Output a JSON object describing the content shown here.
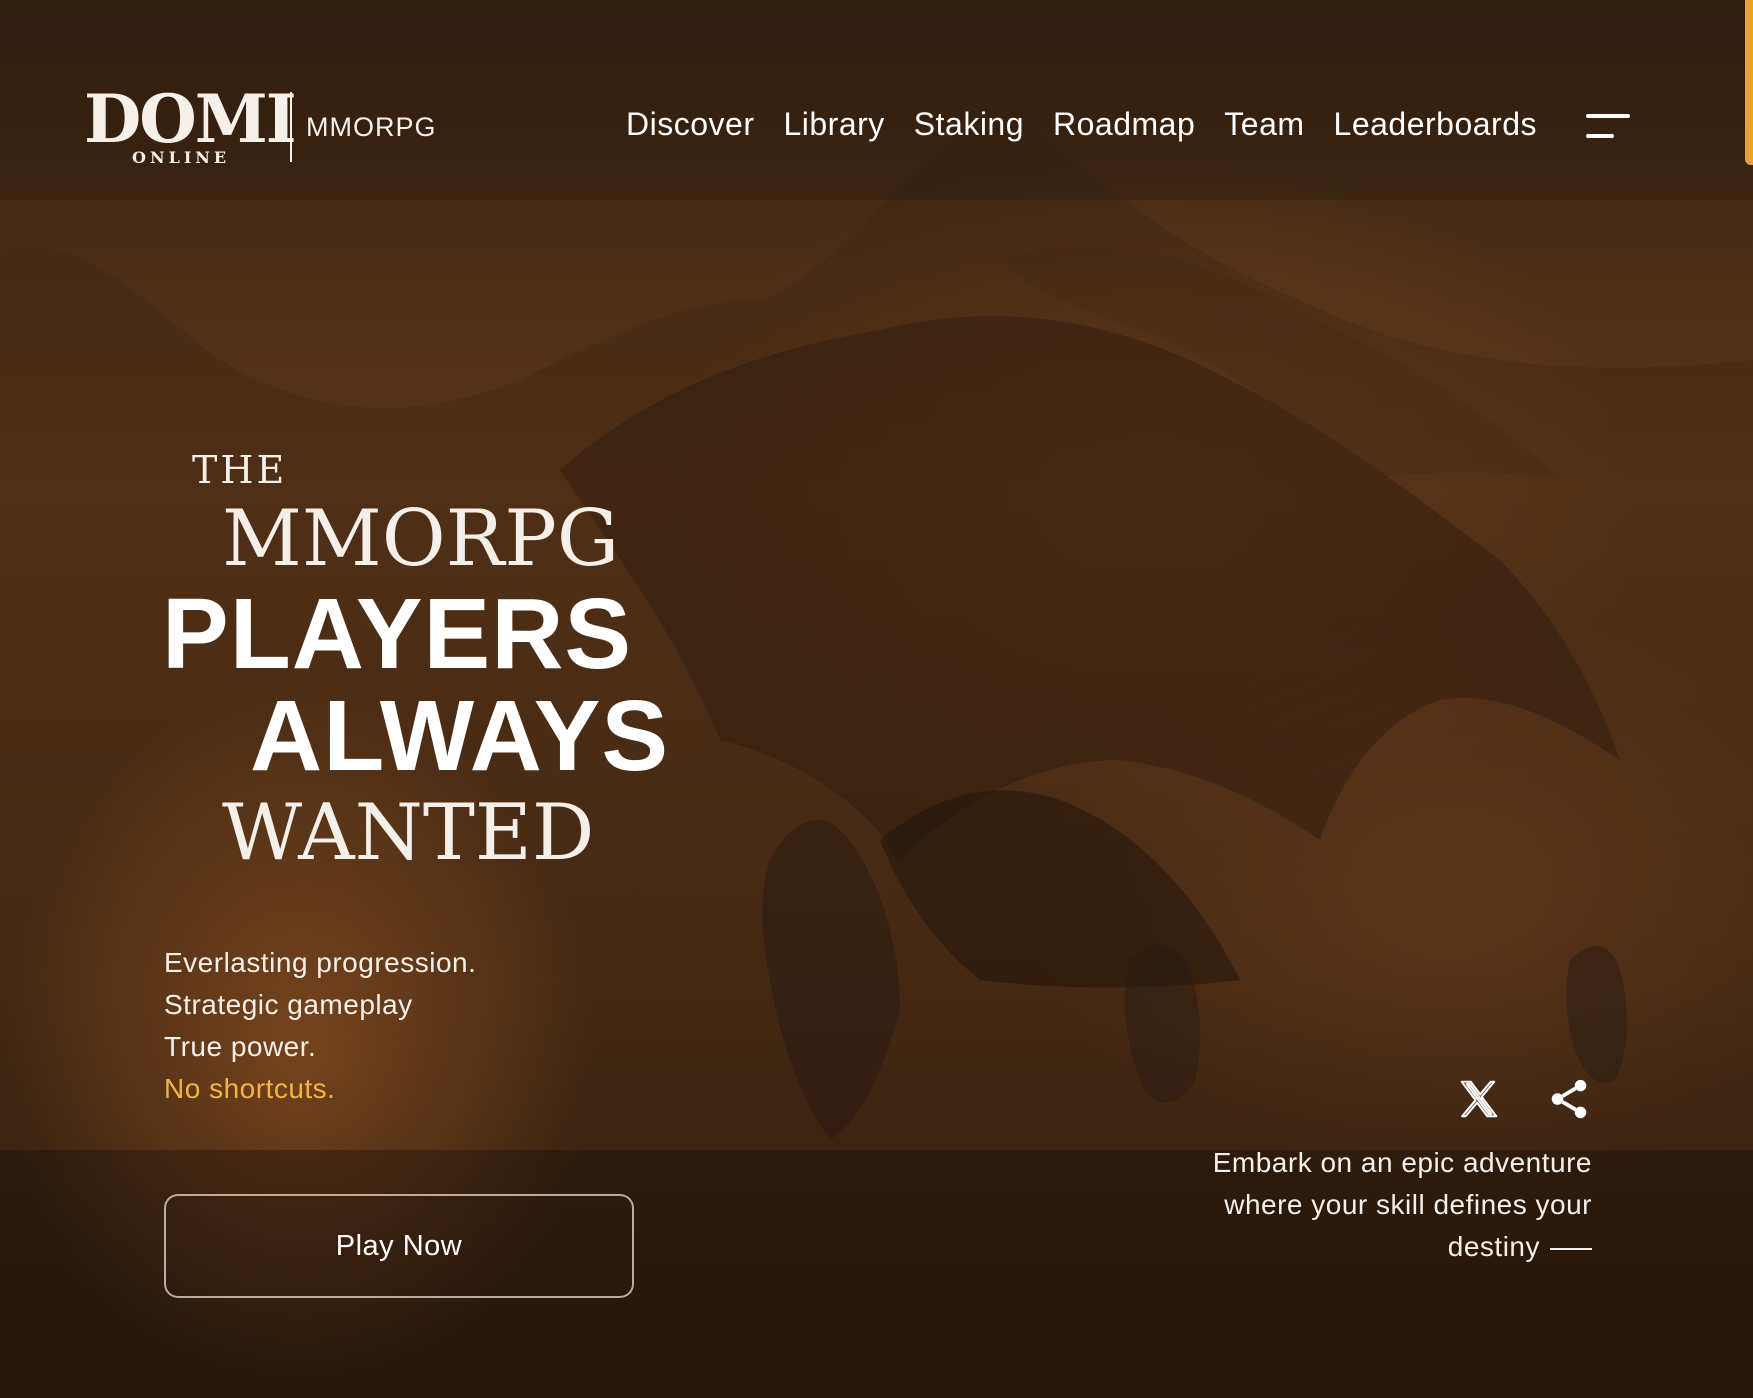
{
  "brand": {
    "logo_word": "DOMI",
    "logo_sub": "ONLINE",
    "tagline": "MMORPG"
  },
  "nav": {
    "items": [
      "Discover",
      "Library",
      "Staking",
      "Roadmap",
      "Team",
      "Leaderboards"
    ],
    "menu_icon": "hamburger-menu-icon"
  },
  "hero": {
    "line_the": "THE",
    "line_mmorpg": "MMORPG",
    "line_players": "PLAYERS",
    "line_always": "ALWAYS",
    "line_wanted": "WANTED"
  },
  "taglines": {
    "line1": "Everlasting progression.",
    "line2": "Strategic gameplay",
    "line3": "True power.",
    "accent": "No shortcuts."
  },
  "cta": {
    "play_label": "Play Now"
  },
  "social": {
    "icons": [
      "x-twitter-icon",
      "share-icon"
    ]
  },
  "embark": {
    "line1": "Embark on an epic adventure",
    "line2": "where your skill defines your",
    "line3": "destiny"
  },
  "colors": {
    "accent": "#f0b545",
    "scroll_indicator": "#e7a33a",
    "text": "#ffffff"
  }
}
